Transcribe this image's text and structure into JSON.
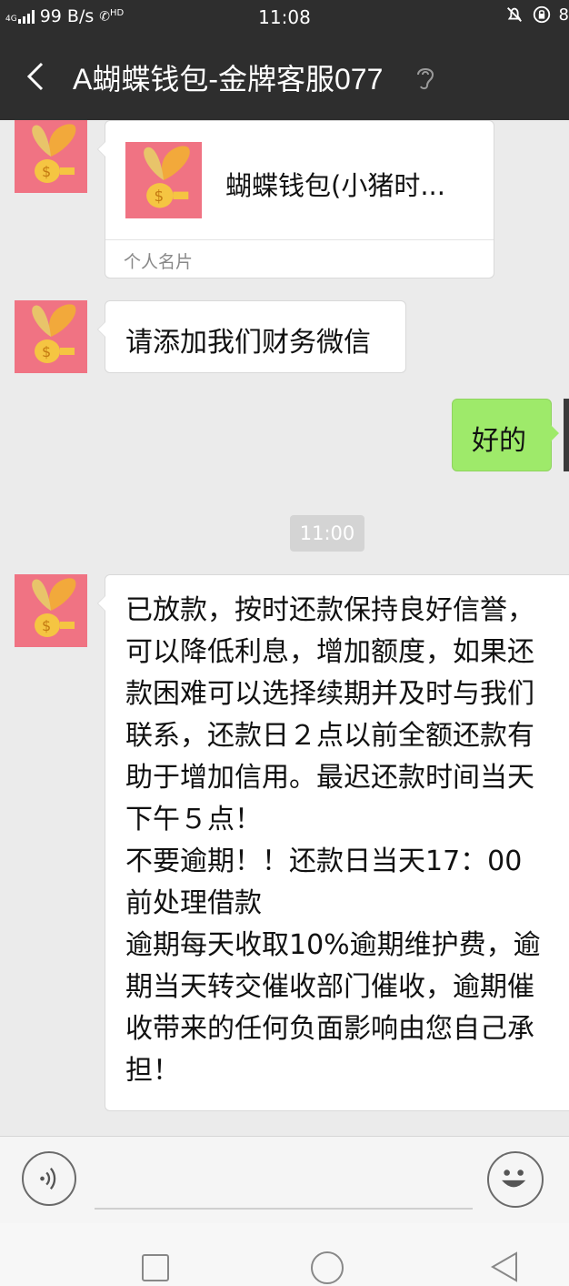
{
  "status_bar": {
    "network": "4G",
    "speed": "99 B/s",
    "hd_label": "HD",
    "time": "11:08",
    "battery_fragment": "8"
  },
  "header": {
    "title": "A蝴蝶钱包-金牌客服077",
    "icons": [
      "back-arrow-icon",
      "ear-icon"
    ]
  },
  "chat": {
    "contact_card": {
      "name": "蝴蝶钱包(小猪时...",
      "footer": "个人名片"
    },
    "messages": [
      {
        "side": "left",
        "text": "请添加我们财务微信"
      },
      {
        "side": "right",
        "text": "好的"
      }
    ],
    "timestamp": "11:00",
    "long_message": {
      "side": "left",
      "lines": [
        "已放款，按时还款保持良好信誉，",
        "可以降低利息，增加额度，如果还",
        "款困难可以选择续期并及时与我们",
        "联系，还款日２点以前全额还款有",
        "助于增加信用。最迟还款时间当天",
        "下午５点！",
        "不要逾期！！还款日当天17：00",
        "前处理借款",
        "逾期每天收取10%逾期维护费，逾",
        "期当天转交催收部门催收，逾期催",
        "收带来的任何负面影响由您自己承",
        "担！"
      ]
    }
  },
  "colors": {
    "header_bg": "#2e2e2e",
    "chat_bg": "#ebebeb",
    "my_bubble": "#9eea6a",
    "avatar_bg": "#f07383"
  }
}
